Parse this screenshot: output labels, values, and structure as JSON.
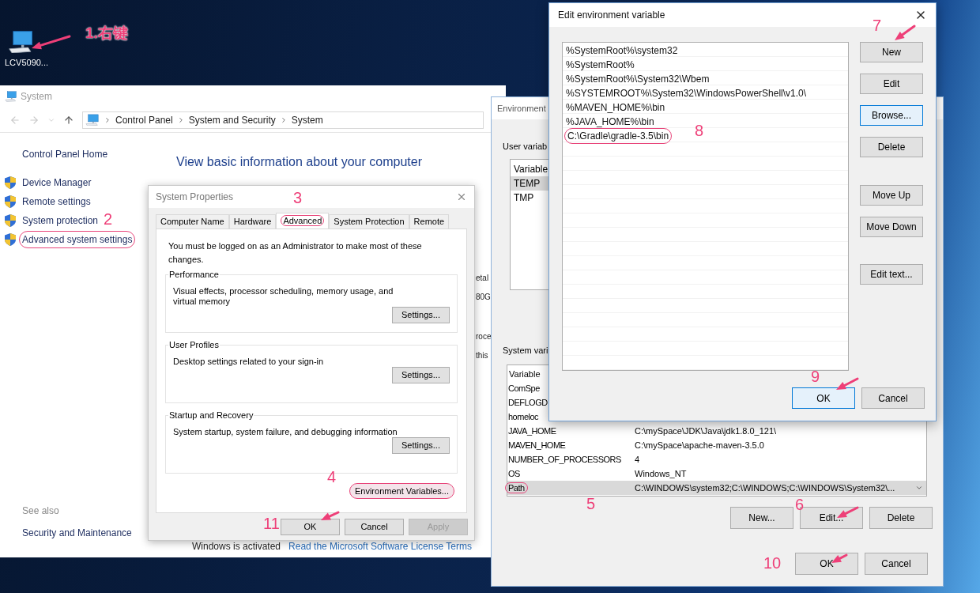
{
  "desktop": {
    "icon_label": "LCV5090..."
  },
  "system_window": {
    "title": "System",
    "breadcrumb": [
      "Control Panel",
      "System and Security",
      "System"
    ],
    "sidebar": {
      "home": "Control Panel Home",
      "items": [
        {
          "label": "Device Manager",
          "highlighted": false
        },
        {
          "label": "Remote settings",
          "highlighted": false
        },
        {
          "label": "System protection",
          "highlighted": false
        },
        {
          "label": "Advanced system settings",
          "highlighted": true
        }
      ],
      "see_also": "See also",
      "see_also_links": [
        "Security and Maintenance"
      ]
    },
    "heading": "View basic information about your computer",
    "covered_fragments": [
      "etal",
      "80G",
      "roce",
      "this"
    ],
    "activation": {
      "status": "Windows is activated",
      "link": "Read the Microsoft Software License Terms"
    }
  },
  "system_properties": {
    "title": "System Properties",
    "tabs": [
      {
        "label": "Computer Name",
        "selected": false,
        "highlighted": false
      },
      {
        "label": "Hardware",
        "selected": false,
        "highlighted": false
      },
      {
        "label": "Advanced",
        "selected": true,
        "highlighted": true
      },
      {
        "label": "System Protection",
        "selected": false,
        "highlighted": false
      },
      {
        "label": "Remote",
        "selected": false,
        "highlighted": false
      }
    ],
    "notice": "You must be logged on as an Administrator to make most of these changes.",
    "groups": [
      {
        "title": "Performance",
        "description": "Visual effects, processor scheduling, memory usage, and virtual memory",
        "button": "Settings..."
      },
      {
        "title": "User Profiles",
        "description": "Desktop settings related to your sign-in",
        "button": "Settings..."
      },
      {
        "title": "Startup and Recovery",
        "description": "System startup, system failure, and debugging information",
        "button": "Settings..."
      }
    ],
    "env_button": {
      "label": "Environment Variables...",
      "highlighted": true
    },
    "buttons": [
      {
        "label": "OK",
        "disabled": false
      },
      {
        "label": "Cancel",
        "disabled": false
      },
      {
        "label": "Apply",
        "disabled": true
      }
    ]
  },
  "environment_variables": {
    "title": "Environment",
    "user_section": "User variab",
    "user_vars": {
      "header": "Variable",
      "rows": [
        {
          "name": "TEMP",
          "selected": true
        },
        {
          "name": "TMP",
          "selected": false
        }
      ]
    },
    "system_section": "System vari",
    "system_vars": {
      "header": "Variable",
      "rows": [
        {
          "name": "ComSpe",
          "selected": false,
          "highlighted": false
        },
        {
          "name": "DEFLOGD",
          "selected": false,
          "highlighted": false
        },
        {
          "name": "homeloc",
          "selected": false,
          "highlighted": false
        },
        {
          "name": "JAVA_HOME",
          "value": "C:\\mySpace\\JDK\\Java\\jdk1.8.0_121\\",
          "selected": false,
          "highlighted": false
        },
        {
          "name": "MAVEN_HOME",
          "value": "C:\\mySpace\\apache-maven-3.5.0",
          "selected": false,
          "highlighted": false
        },
        {
          "name": "NUMBER_OF_PROCESSORS",
          "value": "4",
          "selected": false,
          "highlighted": false
        },
        {
          "name": "OS",
          "value": "Windows_NT",
          "selected": false,
          "highlighted": false
        },
        {
          "name": "Path",
          "value": "C:\\WINDOWS\\system32;C:\\WINDOWS;C:\\WINDOWS\\System32\\...",
          "selected": true,
          "highlighted": true
        }
      ]
    },
    "system_buttons": [
      "New...",
      "Edit...",
      "Delete"
    ],
    "buttons": [
      "OK",
      "Cancel"
    ]
  },
  "edit_dialog": {
    "title": "Edit environment variable",
    "entries": [
      {
        "text": "%SystemRoot%\\system32",
        "highlighted": false
      },
      {
        "text": "%SystemRoot%",
        "highlighted": false
      },
      {
        "text": "%SystemRoot%\\System32\\Wbem",
        "highlighted": false
      },
      {
        "text": "%SYSTEMROOT%\\System32\\WindowsPowerShell\\v1.0\\",
        "highlighted": false
      },
      {
        "text": "%MAVEN_HOME%\\bin",
        "highlighted": false
      },
      {
        "text": "%JAVA_HOME%\\bin",
        "highlighted": false
      },
      {
        "text": "C:\\Gradle\\gradle-3.5\\bin",
        "highlighted": true
      }
    ],
    "side_buttons": [
      {
        "label": "New",
        "focused": false
      },
      {
        "label": "Edit",
        "focused": false
      },
      {
        "label": "Browse...",
        "focused": true
      },
      {
        "label": "Delete",
        "focused": false
      },
      {
        "label": "Move Up",
        "focused": false
      },
      {
        "label": "Move Down",
        "focused": false
      },
      {
        "label": "Edit text...",
        "focused": false
      }
    ],
    "buttons": [
      {
        "label": "OK",
        "focused": true
      },
      {
        "label": "Cancel",
        "focused": false
      }
    ]
  },
  "annotations": [
    {
      "label": "1.右键",
      "arrow": true
    },
    {
      "label": "2",
      "arrow": false
    },
    {
      "label": "3",
      "arrow": false
    },
    {
      "label": "4",
      "arrow": false
    },
    {
      "label": "5",
      "arrow": false
    },
    {
      "label": "6",
      "arrow": true
    },
    {
      "label": "7",
      "arrow": true
    },
    {
      "label": "8",
      "arrow": false
    },
    {
      "label": "9",
      "arrow": true
    },
    {
      "label": "10",
      "arrow": true
    },
    {
      "label": "11",
      "arrow": true
    }
  ]
}
